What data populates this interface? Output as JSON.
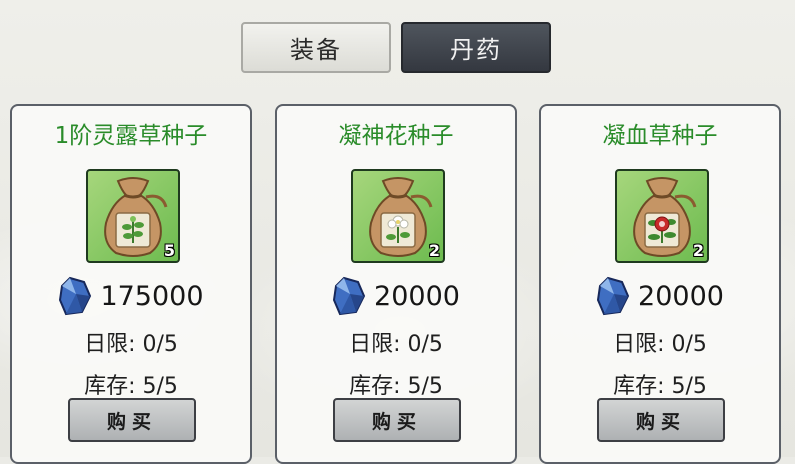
{
  "tabs": [
    {
      "label": "装备",
      "active": false
    },
    {
      "label": "丹药",
      "active": true
    }
  ],
  "currency_icon": "blue-gem-icon",
  "colors": {
    "item_name": "#2a8c2a",
    "tab_active_bg": "#3d4249",
    "card_border": "#5b6068"
  },
  "items": [
    {
      "name": "1阶灵露草种子",
      "icon": "seed-pouch-icon",
      "flower": "green-sprig",
      "count": "5",
      "price": "175000",
      "daily_limit": "日限: 0/5",
      "stock": "库存: 5/5",
      "buy_label": "购买"
    },
    {
      "name": "凝神花种子",
      "icon": "seed-pouch-icon",
      "flower": "white-flower",
      "count": "2",
      "price": "20000",
      "daily_limit": "日限: 0/5",
      "stock": "库存: 5/5",
      "buy_label": "购买"
    },
    {
      "name": "凝血草种子",
      "icon": "seed-pouch-icon",
      "flower": "red-flower",
      "count": "2",
      "price": "20000",
      "daily_limit": "日限: 0/5",
      "stock": "库存: 5/5",
      "buy_label": "购买"
    }
  ]
}
